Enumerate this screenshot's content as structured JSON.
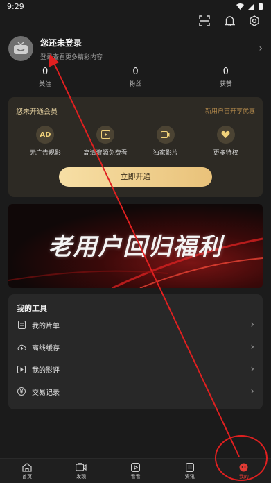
{
  "status_bar": {
    "time": "9:29"
  },
  "profile": {
    "name": "您还未登录",
    "subtitle": "登录查看更多精彩内容",
    "chevron": "›"
  },
  "stats": [
    {
      "value": "0",
      "label": "关注"
    },
    {
      "value": "0",
      "label": "粉丝"
    },
    {
      "value": "0",
      "label": "获赞"
    }
  ],
  "vip": {
    "title": "您未开通会员",
    "promo": "新用户首开享优惠",
    "features": [
      {
        "icon_text": "AD",
        "icon": "ad-icon",
        "label": "无广告观影"
      },
      {
        "icon": "film-icon",
        "label": "高清资源免费看"
      },
      {
        "icon": "video-icon",
        "label": "独家影片"
      },
      {
        "icon": "heart-badge-icon",
        "label": "更多特权"
      }
    ],
    "button": "立即开通"
  },
  "banner": {
    "text": "老用户回归福利"
  },
  "tools": {
    "title": "我的工具",
    "items": [
      {
        "label": "我的片单",
        "icon": "list-icon"
      },
      {
        "label": "离线缓存",
        "icon": "cloud-icon"
      },
      {
        "label": "我的影评",
        "icon": "play-review-icon"
      },
      {
        "label": "交易记录",
        "icon": "yen-icon"
      }
    ],
    "chevron": "›"
  },
  "tabs": [
    {
      "label": "首页",
      "icon": "home-icon"
    },
    {
      "label": "发现",
      "icon": "camera-icon"
    },
    {
      "label": "看看",
      "icon": "play-icon"
    },
    {
      "label": "资讯",
      "icon": "news-icon"
    },
    {
      "label": "我的",
      "icon": "profile-icon",
      "active": true
    }
  ],
  "colors": {
    "background": "#1b1b1b",
    "vip_card": "#2d2a24",
    "vip_gold": "#e9c27a",
    "annotation_red": "#e02020",
    "active_tab": "#e33b35"
  }
}
